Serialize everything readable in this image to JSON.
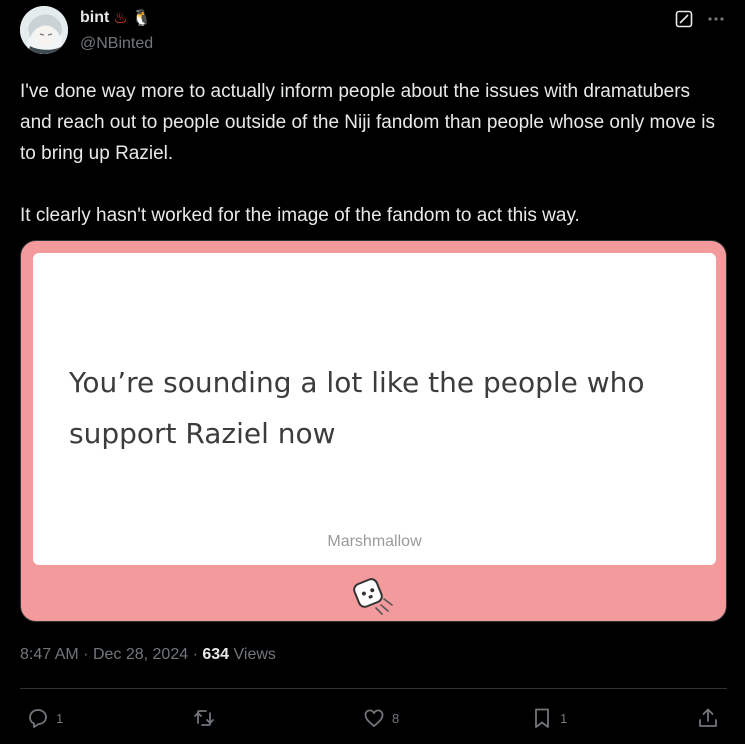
{
  "author": {
    "display_name": "bint",
    "emojis": [
      "♨",
      "🐧"
    ],
    "handle": "@NBinted"
  },
  "tweet": {
    "paragraphs": [
      "I've done way more to actually inform people about the issues with dramatubers and reach out to people outside of the Niji fandom than people whose only move is to bring up Raziel.",
      "It clearly hasn't worked for the image of the fandom to act this way."
    ]
  },
  "media": {
    "question": "You’re sounding a lot like the people who support Raziel now",
    "brand": "Marshmallow",
    "background_color": "#f39a9c"
  },
  "meta": {
    "time": "8:47 AM",
    "separator": "·",
    "date": "Dec 28, 2024",
    "views_count": "634",
    "views_label": "Views"
  },
  "actions": {
    "replies": "1",
    "likes": "8",
    "bookmarks": "1"
  },
  "icons": {
    "grok": "grok-icon",
    "more": "more-icon",
    "reply": "reply-icon",
    "retweet": "retweet-icon",
    "like": "heart-icon",
    "bookmark": "bookmark-icon",
    "share": "share-icon"
  }
}
